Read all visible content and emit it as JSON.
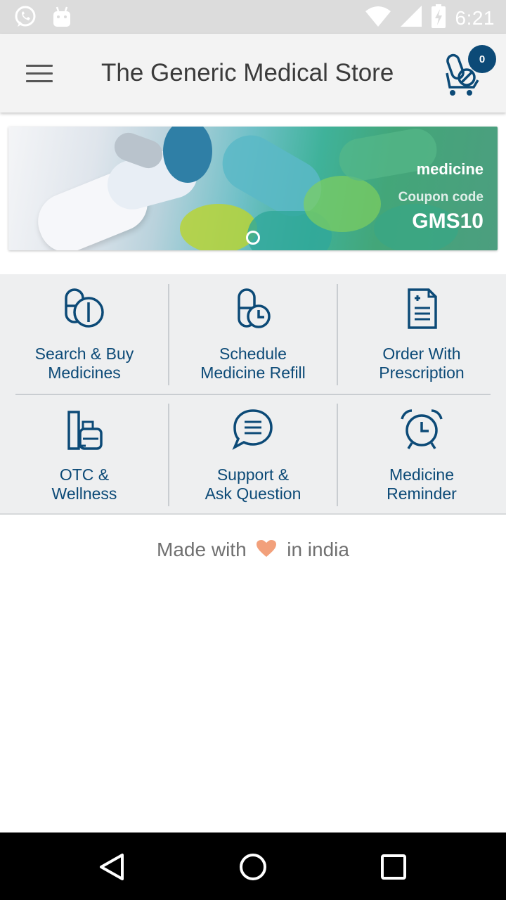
{
  "status_bar": {
    "time": "6:21",
    "icons": [
      "whatsapp-icon",
      "android-icon",
      "wifi-icon",
      "cellular-icon",
      "battery-charging-icon"
    ]
  },
  "app_bar": {
    "title": "The Generic Medical Store",
    "menu_icon": "hamburger-menu-icon",
    "cart_icon": "medicine-cart-icon",
    "cart_count": "0"
  },
  "banner": {
    "title": "medicine",
    "coupon_label": "Coupon code",
    "coupon_code": "GMS10",
    "slides": 1,
    "active_slide": 1
  },
  "tiles": [
    {
      "label_line1": "Search & Buy",
      "label_line2": "Medicines",
      "icon": "pills-icon"
    },
    {
      "label_line1": "Schedule",
      "label_line2": "Medicine Refill",
      "icon": "pill-clock-icon"
    },
    {
      "label_line1": "Order With",
      "label_line2": "Prescription",
      "icon": "prescription-document-icon"
    },
    {
      "label_line1": "OTC &",
      "label_line2": "Wellness",
      "icon": "wellness-bottles-icon"
    },
    {
      "label_line1": "Support &",
      "label_line2": "Ask Question",
      "icon": "chat-bubble-icon"
    },
    {
      "label_line1": "Medicine",
      "label_line2": "Reminder",
      "icon": "alarm-clock-icon"
    }
  ],
  "footer": {
    "made_with": "Made with",
    "in_india": "in india",
    "heart_icon": "heart-icon"
  },
  "colors": {
    "primary": "#0c4a77",
    "heart": "#f2a07b",
    "app_bar_bg": "#f3f3f3",
    "grid_bg": "#eeeff0"
  },
  "nav_bar": {
    "icons": [
      "back-icon",
      "home-icon",
      "recents-icon"
    ]
  }
}
